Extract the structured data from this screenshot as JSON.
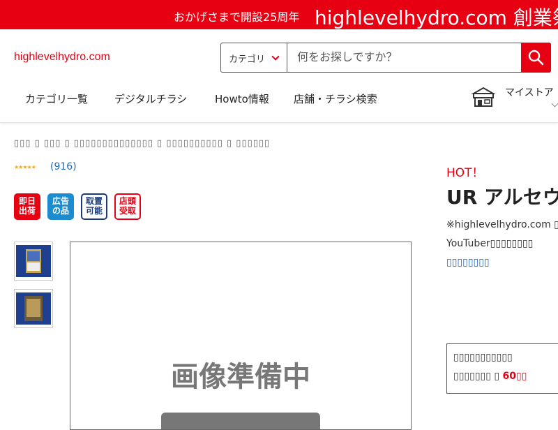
{
  "banner": {
    "small_text": "おかげさまで開設25周年",
    "big_text": "highlevelhydro.com 創業祭"
  },
  "header": {
    "logo": "highlevelhydro.com",
    "search": {
      "category_label": "カテゴリ",
      "placeholder": "何をお探しですか？"
    },
    "nav": [
      "カテゴリ一覧",
      "デジタルチラシ",
      "Howto情報",
      "店舗・チラシ検索"
    ],
    "mystore_label": "マイストア"
  },
  "breadcrumb": "▯▯▯ ▯ ▯▯▯ ▯ ▯▯▯▯▯▯▯▯▯▯▯▯▯▯ ▯ ▯▯▯▯▯▯▯▯▯▯ ▯ ▯▯▯▯▯▯",
  "rating": {
    "stars": "★★★★★",
    "count": "(916)"
  },
  "badges": [
    {
      "line1": "即日",
      "line2": "出荷",
      "color": "#e60012"
    },
    {
      "line1": "広告",
      "line2": "の品",
      "color": "#1b8cd0"
    },
    {
      "line1": "取置",
      "line2": "可能",
      "color": "#1a3b78"
    },
    {
      "line1": "店頭",
      "line2": "受取",
      "color": "#e60012"
    }
  ],
  "main_image_text": "画像準備中",
  "product": {
    "hot_label": "HOT！",
    "title": "UR アルセウ",
    "desc_line1": "※highlevelhydro.com ▯",
    "desc_line2": "YouTuber▯▯▯▯▯▯▯▯",
    "desc_link": "▯▯▯▯▯▯▯▯"
  },
  "notice": {
    "line1": "▯▯▯▯▯▯▯▯▯▯▯",
    "line2_prefix": "▯▯▯▯▯▯▯ ▯ ",
    "line2_highlight": "60▯▯"
  },
  "colors": {
    "brand_red": "#e60012",
    "link_blue": "#1a66c2"
  }
}
